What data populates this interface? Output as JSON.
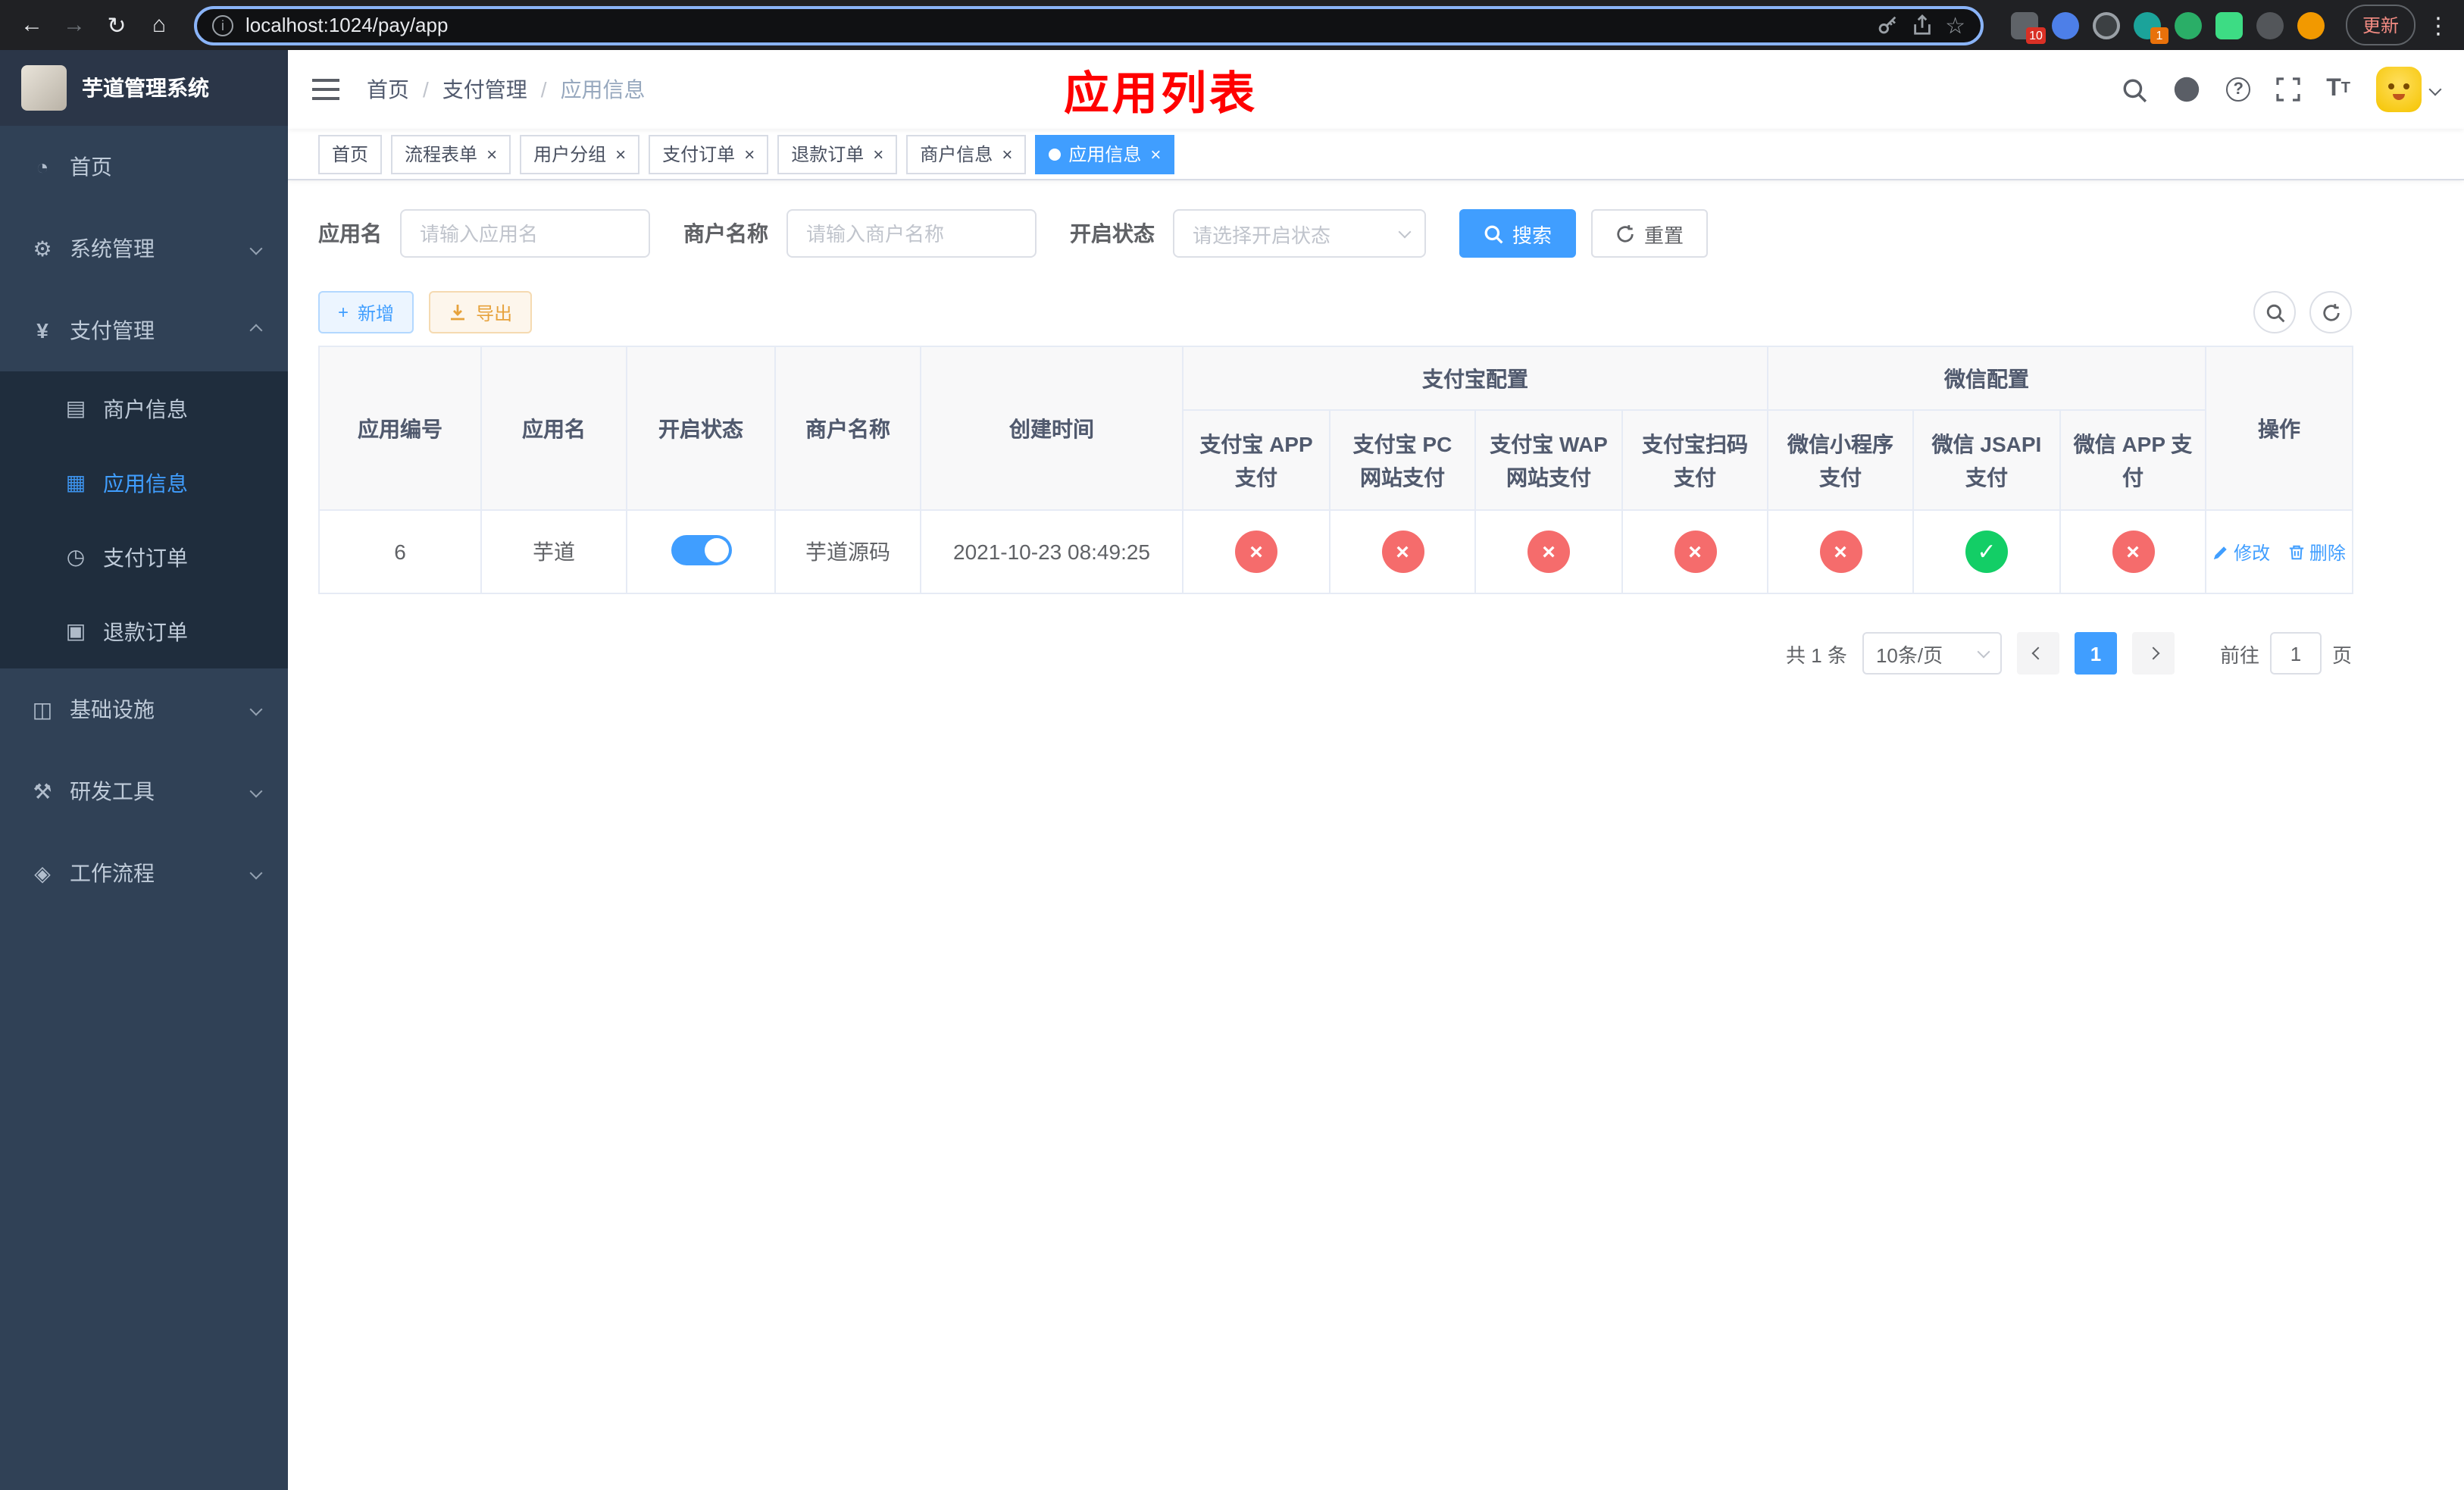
{
  "colors": {
    "primary": "#409eff",
    "success": "#13ce66",
    "danger": "#f56c6c",
    "warning": "#e6a23c",
    "sidebar_bg": "#304156",
    "sidebar_submenu_bg": "#1f2d3d",
    "page_title_red": "#ff0000"
  },
  "browser": {
    "url": "localhost:1024/pay/app",
    "update_button": "更新",
    "extensions_badge": "10",
    "translate_badge": "1"
  },
  "sidebar": {
    "logo_title": "芋道管理系统",
    "items": [
      {
        "label": "首页",
        "icon": "dashboard-icon"
      },
      {
        "label": "系统管理",
        "icon": "gear-icon"
      },
      {
        "label": "支付管理",
        "icon": "yen-icon"
      },
      {
        "label": "基础设施",
        "icon": "infrastructure-icon"
      },
      {
        "label": "研发工具",
        "icon": "devtools-icon"
      },
      {
        "label": "工作流程",
        "icon": "workflow-icon"
      }
    ],
    "pay_children": [
      {
        "label": "商户信息",
        "icon": "card-icon"
      },
      {
        "label": "应用信息",
        "icon": "grid-icon"
      },
      {
        "label": "支付订单",
        "icon": "order-icon"
      },
      {
        "label": "退款订单",
        "icon": "refund-icon"
      }
    ]
  },
  "header": {
    "breadcrumb": [
      "首页",
      "支付管理",
      "应用信息"
    ],
    "separator": "/",
    "page_title": "应用列表"
  },
  "tabs": {
    "close_glyph": "×",
    "items": [
      {
        "label": "首页"
      },
      {
        "label": "流程表单"
      },
      {
        "label": "用户分组"
      },
      {
        "label": "支付订单"
      },
      {
        "label": "退款订单"
      },
      {
        "label": "商户信息"
      },
      {
        "label": "应用信息"
      }
    ]
  },
  "filters": {
    "app_name_label": "应用名",
    "app_name_placeholder": "请输入应用名",
    "merchant_label": "商户名称",
    "merchant_placeholder": "请输入商户名称",
    "status_label": "开启状态",
    "status_placeholder": "请选择开启状态",
    "search_button": "搜索",
    "reset_button": "重置"
  },
  "toolbar": {
    "add_button": "新增",
    "export_button": "导出"
  },
  "table": {
    "group_alipay": "支付宝配置",
    "group_wechat": "微信配置",
    "col_app_id": "应用编号",
    "col_app_name": "应用名",
    "col_status": "开启状态",
    "col_merchant": "商户名称",
    "col_created": "创建时间",
    "col_alipay_app": "支付宝 APP 支付",
    "col_alipay_pc": "支付宝 PC 网站支付",
    "col_alipay_wap": "支付宝 WAP 网站支付",
    "col_alipay_qr": "支付宝扫码支付",
    "col_wx_lite": "微信小程序支付",
    "col_wx_jsapi": "微信 JSAPI 支付",
    "col_wx_app": "微信 APP 支付",
    "col_actions": "操作",
    "flag_on_glyph": "✓",
    "flag_off_glyph": "×",
    "rows": [
      {
        "app_id": "6",
        "app_name": "芋道",
        "enabled": true,
        "merchant": "芋道源码",
        "created_at": "2021-10-23 08:49:25",
        "alipay_app": false,
        "alipay_pc": false,
        "alipay_wap": false,
        "alipay_qr": false,
        "wx_lite": false,
        "wx_jsapi": true,
        "wx_app": false,
        "edit_label": "修改",
        "delete_label": "删除"
      }
    ]
  },
  "pagination": {
    "total": "共 1 条",
    "page_size": "10条/页",
    "current_page": "1",
    "goto_label": "前往",
    "goto_value": "1",
    "goto_unit": "页"
  }
}
